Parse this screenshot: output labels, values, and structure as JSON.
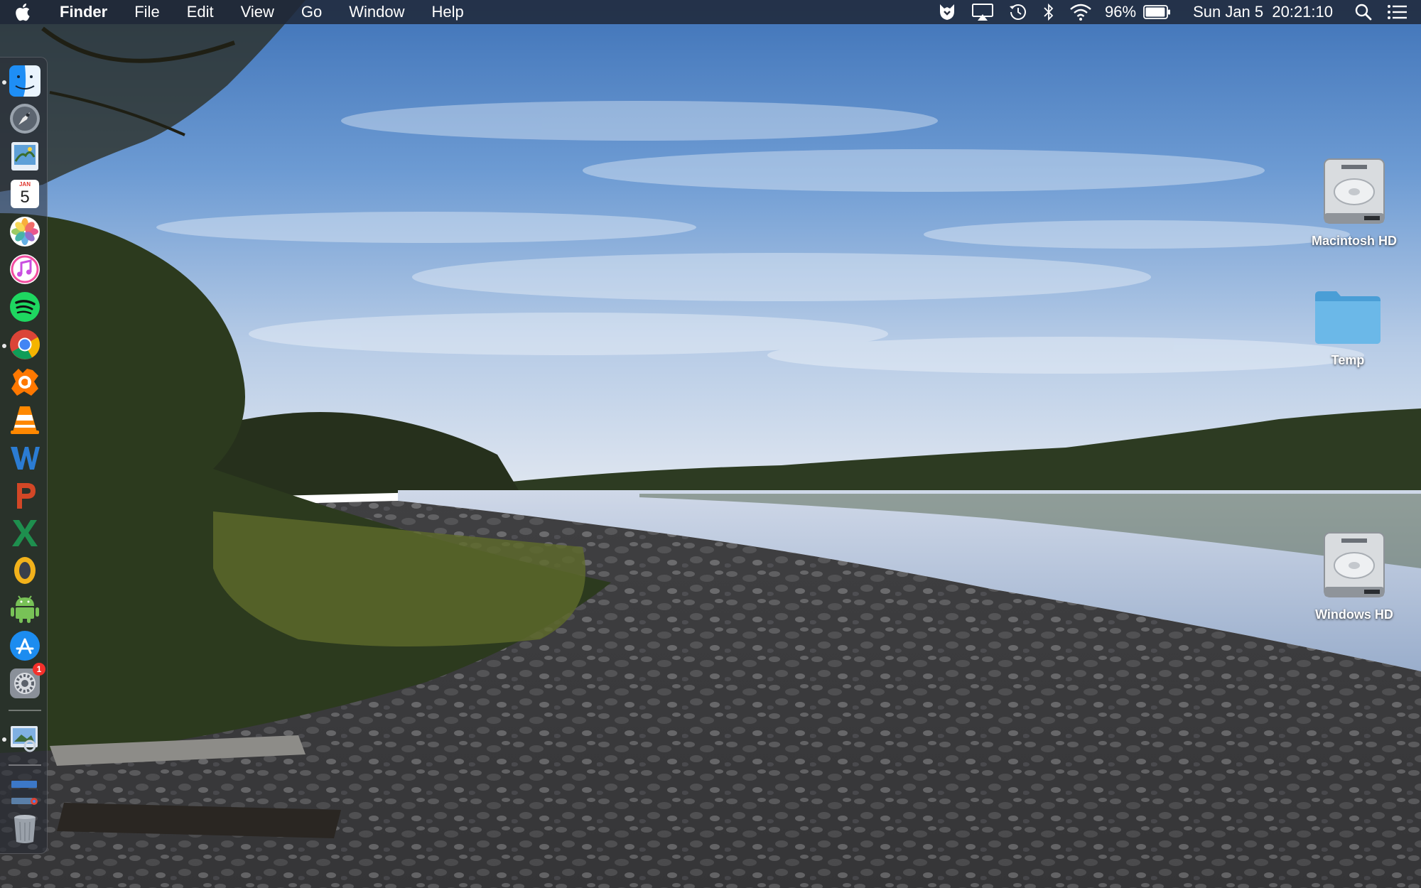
{
  "menubar": {
    "app_name": "Finder",
    "menus": [
      "File",
      "Edit",
      "View",
      "Go",
      "Window",
      "Help"
    ],
    "battery_percent": "96%",
    "battery_level": 0.96,
    "clock": "Sun Jan 5  20:21:10",
    "status_icons": [
      "malwarebytes-icon",
      "airplay-icon",
      "time-machine-icon",
      "bluetooth-icon",
      "wifi-icon",
      "battery-icon",
      "spotlight-icon",
      "notification-center-icon"
    ]
  },
  "dock": {
    "apps": [
      {
        "name": "finder",
        "running": true
      },
      {
        "name": "launchpad",
        "running": false
      },
      {
        "name": "preview",
        "running": false
      },
      {
        "name": "calendar",
        "running": false
      },
      {
        "name": "photos",
        "running": false
      },
      {
        "name": "itunes",
        "running": false
      },
      {
        "name": "spotify",
        "running": false
      },
      {
        "name": "chrome",
        "running": true
      },
      {
        "name": "avast",
        "running": false
      },
      {
        "name": "vlc",
        "running": false
      },
      {
        "name": "word",
        "running": false
      },
      {
        "name": "powerpoint",
        "running": false
      },
      {
        "name": "excel",
        "running": false
      },
      {
        "name": "outlook",
        "running": false
      },
      {
        "name": "android-studio",
        "running": false
      },
      {
        "name": "app-store",
        "running": false
      },
      {
        "name": "system-preferences",
        "running": false
      }
    ],
    "calendar_month": "JAN",
    "calendar_day": "5",
    "system_preferences_badge": "1",
    "colors": {
      "spotify": "#1ed760",
      "avast": "#ff7800",
      "word": "#2b7cd3",
      "powerpoint": "#d24726",
      "excel": "#1e8f4e",
      "outlook": "#f2b21b"
    }
  },
  "desktop": {
    "icons": [
      {
        "label": "Macintosh HD",
        "type": "drive"
      },
      {
        "label": "Temp",
        "type": "folder"
      },
      {
        "label": "Windows HD",
        "type": "drive"
      }
    ]
  }
}
